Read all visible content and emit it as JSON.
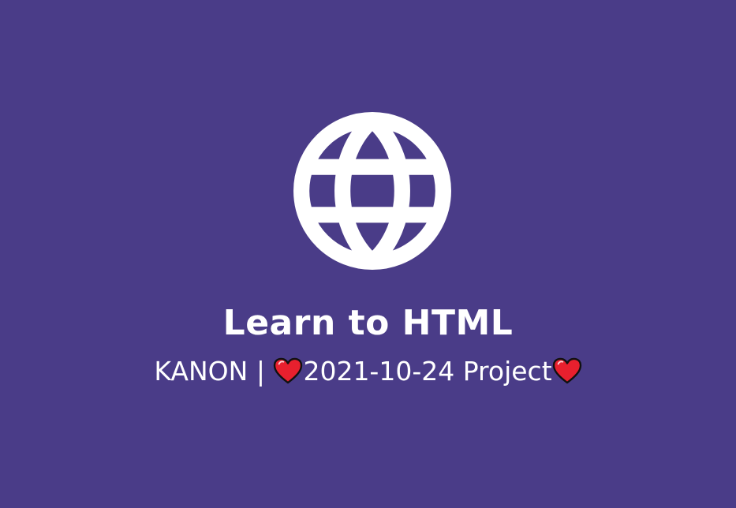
{
  "colors": {
    "background": "#4a3c88",
    "foreground": "#ffffff",
    "heart": "#e8202e"
  },
  "icon": "globe-icon",
  "title": "Learn to HTML",
  "subtitle": {
    "author": "KANON",
    "separator": "|",
    "date": "2021-10-24",
    "suffix": "Project",
    "decoration_icon": "heart-icon"
  }
}
